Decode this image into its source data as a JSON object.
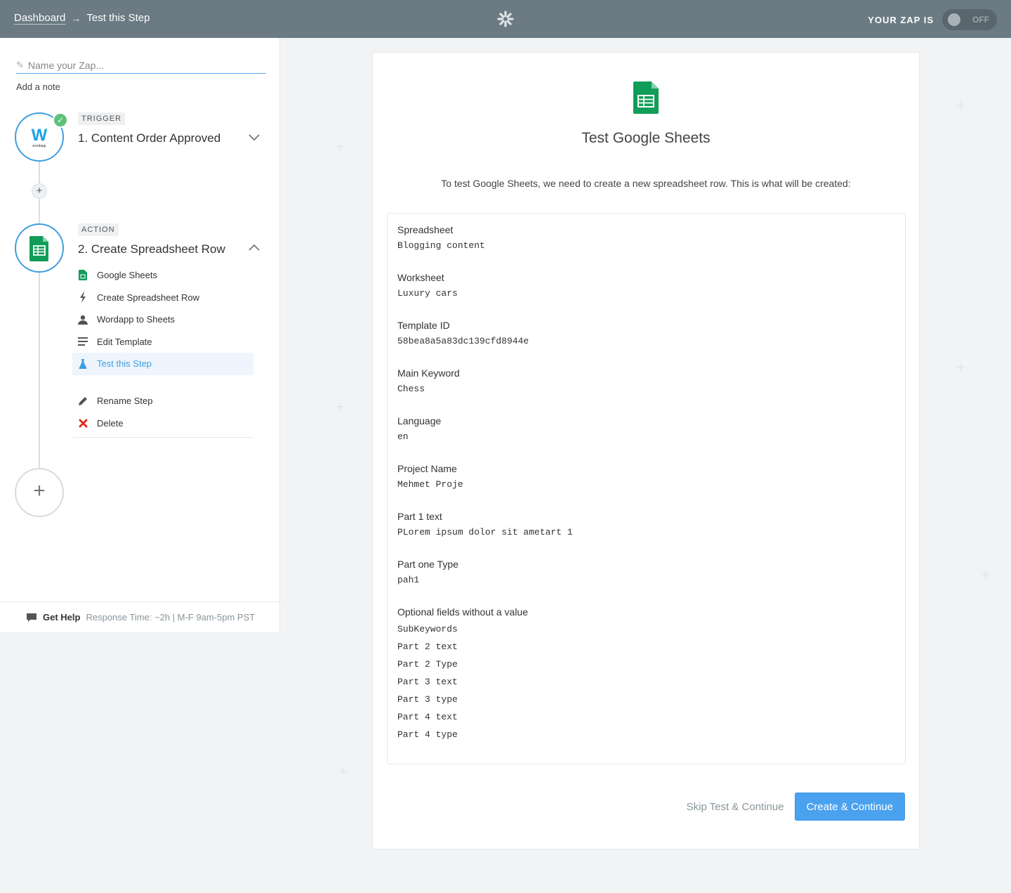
{
  "topbar": {
    "breadcrumb_home": "Dashboard",
    "breadcrumb_arrow": "→",
    "breadcrumb_current": "Test this Step",
    "zap_status_label": "YOUR ZAP IS",
    "toggle_state": "OFF"
  },
  "sidebar": {
    "zap_name_placeholder": "Name your Zap...",
    "add_note": "Add a note",
    "trigger": {
      "tag": "TRIGGER",
      "title": "1. Content Order Approved",
      "app_logo_text": "W",
      "app_logo_sub": "wordapp"
    },
    "action": {
      "tag": "ACTION",
      "title": "2. Create Spreadsheet Row",
      "menu": [
        {
          "label": "Google Sheets",
          "icon": "google-sheets-icon"
        },
        {
          "label": "Create Spreadsheet Row",
          "icon": "bolt-icon"
        },
        {
          "label": "Wordapp to Sheets",
          "icon": "person-icon"
        },
        {
          "label": "Edit Template",
          "icon": "lines-icon"
        },
        {
          "label": "Test this Step",
          "icon": "flask-icon"
        }
      ],
      "menu_extra": [
        {
          "label": "Rename Step",
          "icon": "pencil-icon"
        },
        {
          "label": "Delete",
          "icon": "x-icon"
        }
      ]
    },
    "help": {
      "label": "Get Help",
      "meta": "Response Time: ~2h | M-F 9am-5pm PST"
    }
  },
  "card": {
    "title": "Test Google Sheets",
    "intro": "To test Google Sheets, we need to create a new spreadsheet row. This is what will be created:",
    "fields": [
      {
        "label": "Spreadsheet",
        "value": "Blogging content"
      },
      {
        "label": "Worksheet",
        "value": "Luxury cars"
      },
      {
        "label": "Template ID",
        "value": "58bea8a5a83dc139cfd8944e"
      },
      {
        "label": "Main Keyword",
        "value": "Chess"
      },
      {
        "label": "Language",
        "value": "en"
      },
      {
        "label": "Project Name",
        "value": "Mehmet Proje"
      },
      {
        "label": "Part 1 text",
        "value": "PLorem ipsum dolor sit ametart 1"
      },
      {
        "label": "Part one Type",
        "value": "pah1"
      }
    ],
    "optional_title": "Optional fields without a value",
    "optional_fields": [
      "SubKeywords",
      "Part 2 text",
      "Part 2 Type",
      "Part 3 text",
      "Part 3 type",
      "Part 4 text",
      "Part 4 type"
    ],
    "skip_label": "Skip Test & Continue",
    "create_label": "Create & Continue"
  },
  "colors": {
    "topbar": "#6b7a83",
    "accent": "#3f9ee2",
    "sheets_green": "#0f9d58",
    "success": "#5dc178",
    "delete": "#e0301e"
  }
}
